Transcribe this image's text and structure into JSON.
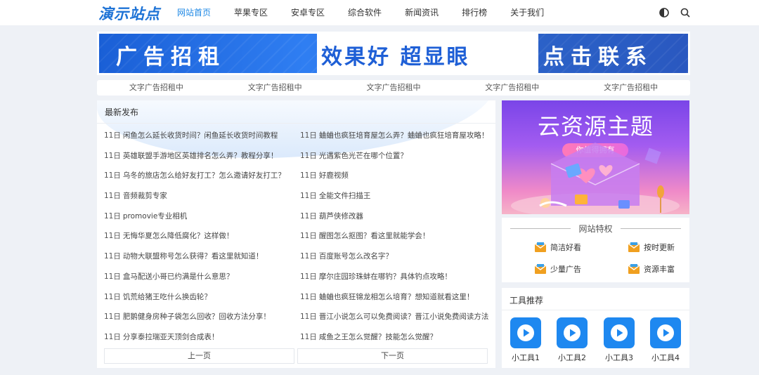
{
  "header": {
    "logo": "演示站点",
    "nav": [
      "网站首页",
      "苹果专区",
      "安卓专区",
      "综合软件",
      "新闻资讯",
      "排行榜",
      "关于我们"
    ],
    "theme_icon": "contrast-icon",
    "search_icon": "search-icon"
  },
  "banner": {
    "left": "广告招租",
    "middle": "效果好 超显眼",
    "right": "点击联系"
  },
  "text_ads": [
    "文字广告招租中",
    "文字广告招租中",
    "文字广告招租中",
    "文字广告招租中",
    "文字广告招租中"
  ],
  "latest": {
    "title": "最新发布",
    "left": [
      {
        "date": "11日",
        "title": "闲鱼怎么延长收货时间？闲鱼延长收货时间教程"
      },
      {
        "date": "11日",
        "title": "英雄联盟手游地区英雄排名怎么弄？教程分享！"
      },
      {
        "date": "11日",
        "title": "乌冬的旅店怎么给好友打工？怎么邀请好友打工？"
      },
      {
        "date": "11日",
        "title": "音频裁剪专家"
      },
      {
        "date": "11日",
        "title": "promovie专业相机"
      },
      {
        "date": "11日",
        "title": "无悔华夏怎么降低腐化？这样做！"
      },
      {
        "date": "11日",
        "title": "动物大联盟称号怎么获得？看这里就知道！"
      },
      {
        "date": "11日",
        "title": "盒马配送小哥已约满是什么意思？"
      },
      {
        "date": "11日",
        "title": "饥荒给猪王吃什么换齿轮？"
      },
      {
        "date": "11日",
        "title": "肥鹅健身房种子袋怎么回收？回收方法分享！"
      },
      {
        "date": "11日",
        "title": "分享泰拉瑞亚天顶剑合成表！"
      }
    ],
    "right": [
      {
        "date": "11日",
        "title": "蛐蛐也疯狂培育屋怎么弄？蛐蛐也疯狂培育屋攻略！"
      },
      {
        "date": "11日",
        "title": "光遇紫色光芒在哪个位置？"
      },
      {
        "date": "11日",
        "title": "好鹿视频"
      },
      {
        "date": "11日",
        "title": "全能文件扫描王"
      },
      {
        "date": "11日",
        "title": "葫芦侠修改器"
      },
      {
        "date": "11日",
        "title": "醒图怎么抠图？看这里就能学会！"
      },
      {
        "date": "11日",
        "title": "百度账号怎么改名字？"
      },
      {
        "date": "11日",
        "title": "摩尔庄园珍珠蚌在哪钓？具体钓点攻略！"
      },
      {
        "date": "11日",
        "title": "蛐蛐也疯狂锦龙相怎么培育？想知道就看这里！"
      },
      {
        "date": "11日",
        "title": "晋江小说怎么可以免费阅读？晋江小说免费阅读方法"
      },
      {
        "date": "11日",
        "title": "咸鱼之王怎么觉醒？技能怎么觉醒？"
      }
    ],
    "prev": "上一页",
    "next": "下一页"
  },
  "promo": {
    "title": "云资源主题",
    "pill": "你值得拥有"
  },
  "features": {
    "title": "网站特权",
    "items": [
      "简洁好看",
      "按时更新",
      "少量广告",
      "资源丰富"
    ],
    "icon_color": "#f0a020"
  },
  "tools": {
    "title": "工具推荐",
    "items": [
      "小工具1",
      "小工具2",
      "小工具3",
      "小工具4"
    ],
    "icon_color": "#1e88f0"
  }
}
